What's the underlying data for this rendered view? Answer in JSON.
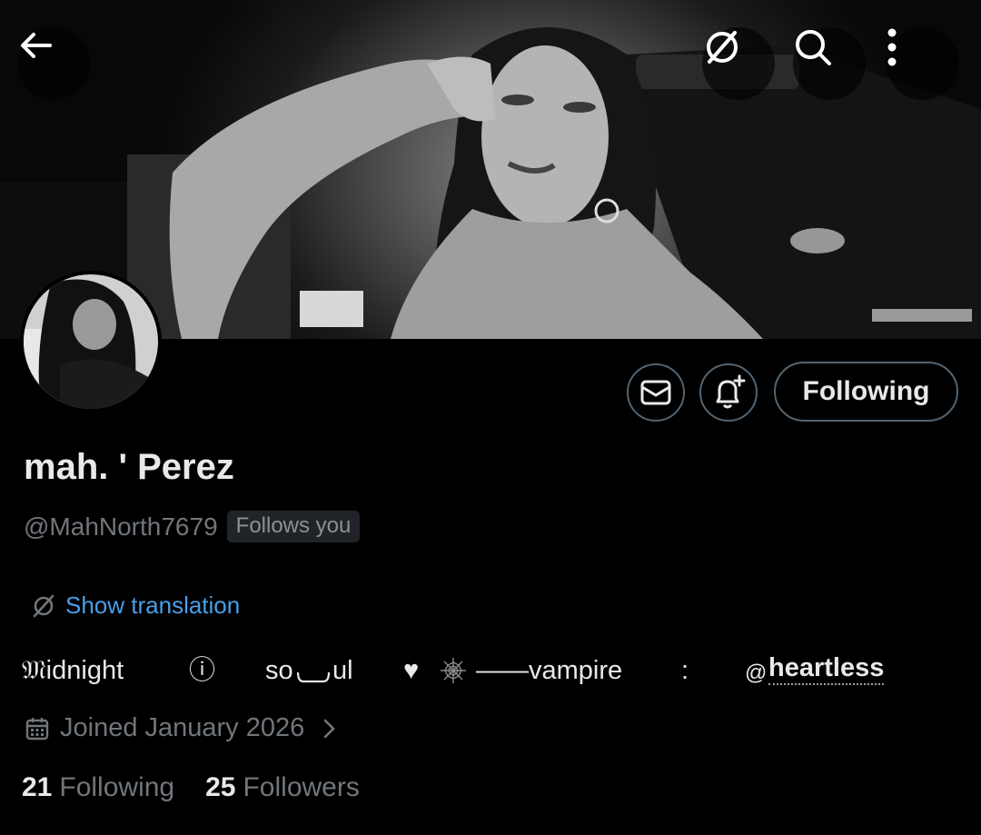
{
  "header": {
    "back_icon": "arrow-left-icon",
    "grok_icon": "grok-icon",
    "search_icon": "search-icon",
    "more_icon": "more-vertical-icon"
  },
  "actions": {
    "message_icon": "envelope-icon",
    "notify_icon": "bell-plus-icon",
    "follow_label": "Following"
  },
  "profile": {
    "name": "mah. ' Perez",
    "handle": "@MahNorth7679",
    "follows_you": "Follows you",
    "show_translation": "Show translation"
  },
  "bio": {
    "word1": "𝔐idnight",
    "info_symbol": "ⓘ",
    "soul_a": "so",
    "soul_b": "ul",
    "heart": "♥",
    "vampire": "——vampire",
    "colon": ":",
    "at": "@",
    "heartless": "heartless"
  },
  "meta": {
    "joined": "Joined January 2026"
  },
  "stats": {
    "following_count": "21",
    "following_label": "Following",
    "followers_count": "25",
    "followers_label": "Followers"
  },
  "colors": {
    "background": "#000000",
    "text_primary": "#e7e9ea",
    "text_secondary": "#71767b",
    "link": "#4a9fe8",
    "border": "#536471"
  }
}
